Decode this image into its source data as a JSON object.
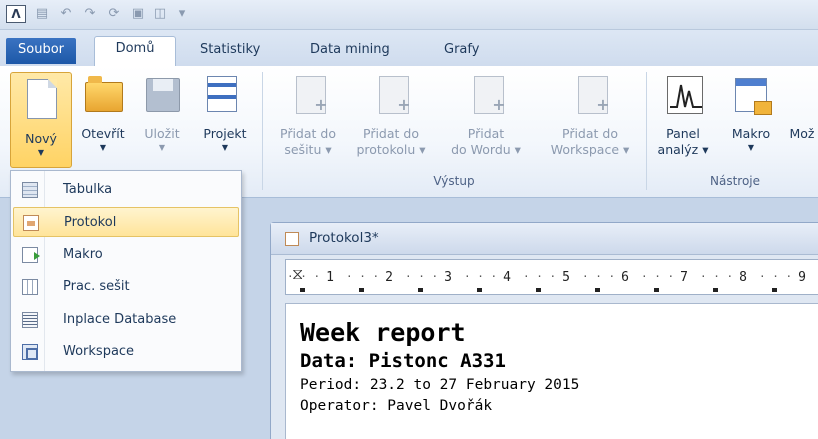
{
  "quick_access": {
    "logo": "Λ"
  },
  "tabs": [
    {
      "label": "Soubor"
    },
    {
      "label": "Domů"
    },
    {
      "label": "Statistiky"
    },
    {
      "label": "Data mining"
    },
    {
      "label": "Grafy"
    }
  ],
  "ribbon": {
    "new": {
      "label": "Nový"
    },
    "open": {
      "label": "Otevřít"
    },
    "save": {
      "label": "Uložit"
    },
    "project": {
      "label": "Projekt"
    },
    "add_workbook": {
      "line1": "Přidat do",
      "line2": "sešitu"
    },
    "add_protocol": {
      "line1": "Přidat do",
      "line2": "protokolu"
    },
    "add_word": {
      "line1": "Přidat",
      "line2": "do Wordu"
    },
    "add_workspace": {
      "line1": "Přidat do",
      "line2": "Workspace"
    },
    "group_output": "Výstup",
    "panel": {
      "line1": "Panel",
      "line2": "analýz"
    },
    "macro": {
      "label": "Makro"
    },
    "more": {
      "label": "Mož"
    },
    "group_tools": "Nástroje"
  },
  "new_menu": {
    "items": [
      {
        "label": "Tabulka",
        "icon": "table-icon"
      },
      {
        "label": "Protokol",
        "icon": "protocol-icon"
      },
      {
        "label": "Makro",
        "icon": "macro-icon"
      },
      {
        "label": "Prac. sešit",
        "icon": "workbook-icon"
      },
      {
        "label": "Inplace Database",
        "icon": "database-icon"
      },
      {
        "label": "Workspace",
        "icon": "workspace-icon"
      }
    ],
    "active_index": 1
  },
  "document": {
    "title": "Protokol3*",
    "ruler_numbers": [
      "1",
      "2",
      "3",
      "4",
      "5",
      "6",
      "7",
      "8",
      "9"
    ],
    "report_title": "Week report",
    "report_data": "Data: Pistonc A331",
    "report_period": "Period: 23.2 to 27 February 2015",
    "report_operator": "Operator: Pavel Dvořák"
  }
}
